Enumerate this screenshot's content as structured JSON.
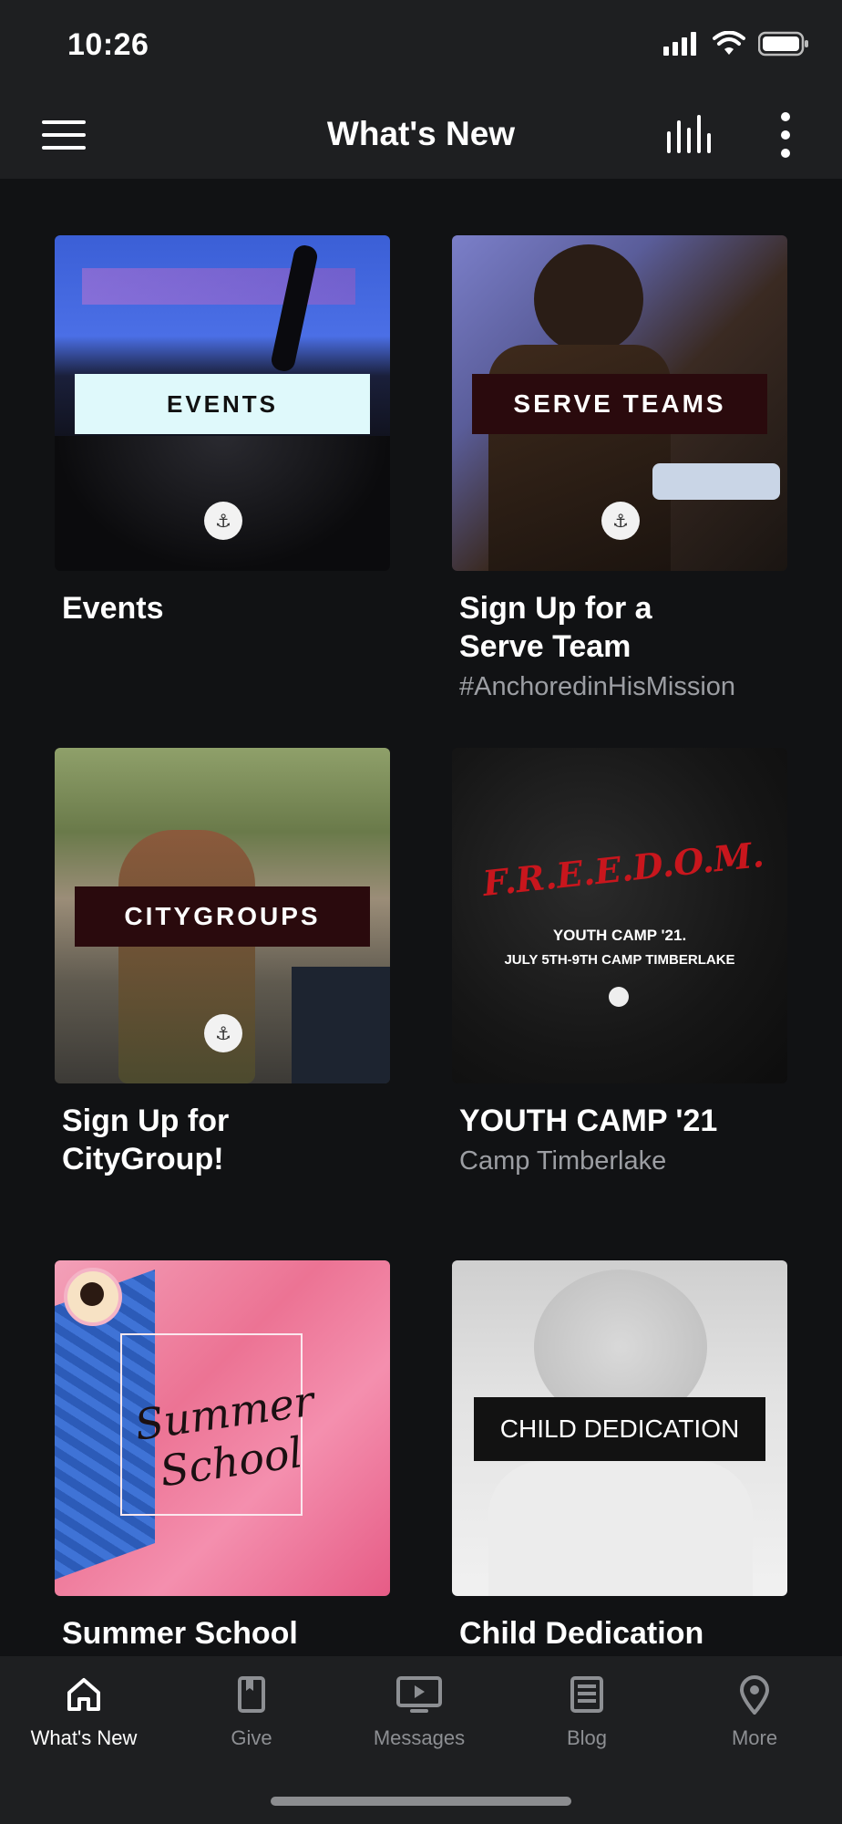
{
  "status": {
    "time": "10:26"
  },
  "header": {
    "title": "What's New"
  },
  "cards": [
    {
      "image_label": "EVENTS",
      "title": "Events",
      "subtitle": ""
    },
    {
      "image_label": "SERVE TEAMS",
      "title": "Sign Up for a Serve Team",
      "subtitle": "#AnchoredinHisMission"
    },
    {
      "image_label": "CITYGROUPS",
      "title": "Sign Up for CityGroup!",
      "subtitle": ""
    },
    {
      "image_label": "F.R.E.E.D.O.M.",
      "image_line1": "YOUTH CAMP '21.",
      "image_line2": "JULY 5TH-9TH CAMP TIMBERLAKE",
      "title": "YOUTH CAMP '21",
      "subtitle": "Camp Timberlake"
    },
    {
      "image_label": "Summer School",
      "title": "Summer School",
      "subtitle": ""
    },
    {
      "image_label": "CHILD DEDICATION",
      "title": "Child Dedication",
      "subtitle": ""
    }
  ],
  "tabs": [
    {
      "label": "What's New",
      "icon": "home-icon",
      "active": true
    },
    {
      "label": "Give",
      "icon": "book-icon",
      "active": false
    },
    {
      "label": "Messages",
      "icon": "tv-play-icon",
      "active": false
    },
    {
      "label": "Blog",
      "icon": "news-icon",
      "active": false
    },
    {
      "label": "More",
      "icon": "location-pin-icon",
      "active": false
    }
  ],
  "colors": {
    "background": "#111214",
    "bar": "#1e1f21",
    "inactive_tab": "#8d8f93",
    "banner_dark": "#2a0a0d",
    "banner_light": "#dff9fb"
  }
}
